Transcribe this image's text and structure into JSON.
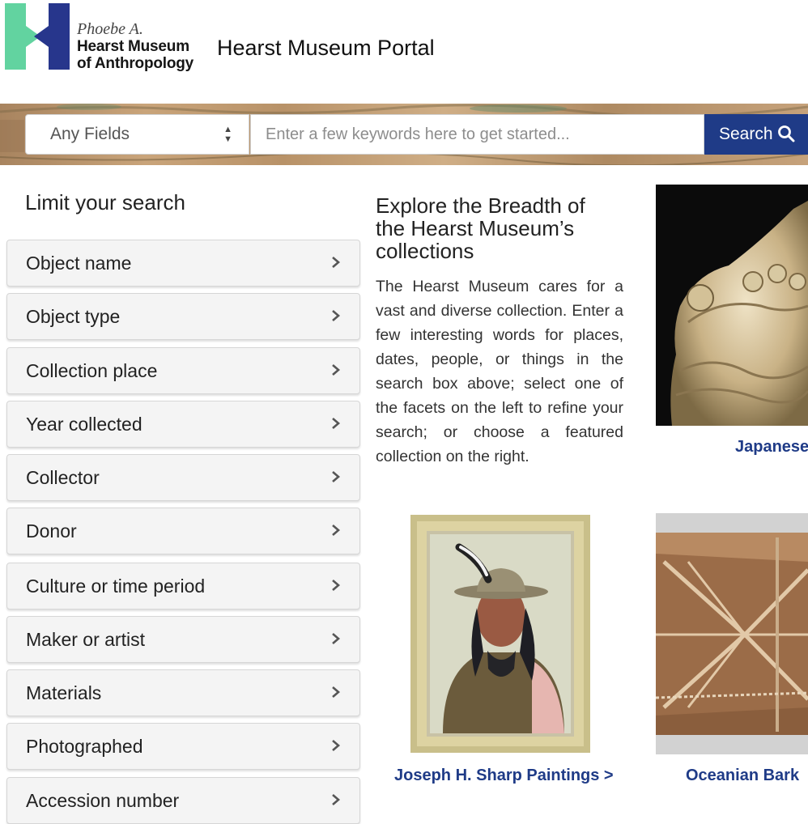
{
  "header": {
    "logo": {
      "line1": "Phoebe A.",
      "line2": "Hearst Museum",
      "line3": "of Anthropology",
      "colors": {
        "green": "#62d3a0",
        "navy": "#27368c"
      }
    },
    "portal_title": "Hearst Museum Portal"
  },
  "search": {
    "field_select_value": "Any Fields",
    "input_placeholder": "Enter a few keywords here to get started...",
    "input_value": "",
    "button_label": "Search",
    "button_icon": "magnifier-icon",
    "accent_color": "#1f3b87"
  },
  "sidebar": {
    "title": "Limit your search",
    "facets": [
      {
        "label": "Object name"
      },
      {
        "label": "Object type"
      },
      {
        "label": "Collection place"
      },
      {
        "label": "Year collected"
      },
      {
        "label": "Collector"
      },
      {
        "label": "Donor"
      },
      {
        "label": "Culture or time period"
      },
      {
        "label": "Maker or artist"
      },
      {
        "label": "Materials"
      },
      {
        "label": "Photographed"
      },
      {
        "label": "Accession number"
      }
    ],
    "chevron_icon": "chevron-right-icon"
  },
  "explore": {
    "title": "Explore the Breadth of the Hearst Museum’s collections",
    "body": "The Hearst Museum cares for a vast and diverse collection. Enter a few interesting words for places, dates, people, or things in the search box above; select one of the facets on the left to refine your search; or choose a featured collection on the right."
  },
  "featured": [
    {
      "label": "Japanese",
      "image": "ivory-boat-carving-image"
    },
    {
      "label": "Joseph H. Sharp Paintings >",
      "image": "portrait-painting-image"
    },
    {
      "label": "Oceanian Bark",
      "image": "bark-painting-image"
    }
  ]
}
